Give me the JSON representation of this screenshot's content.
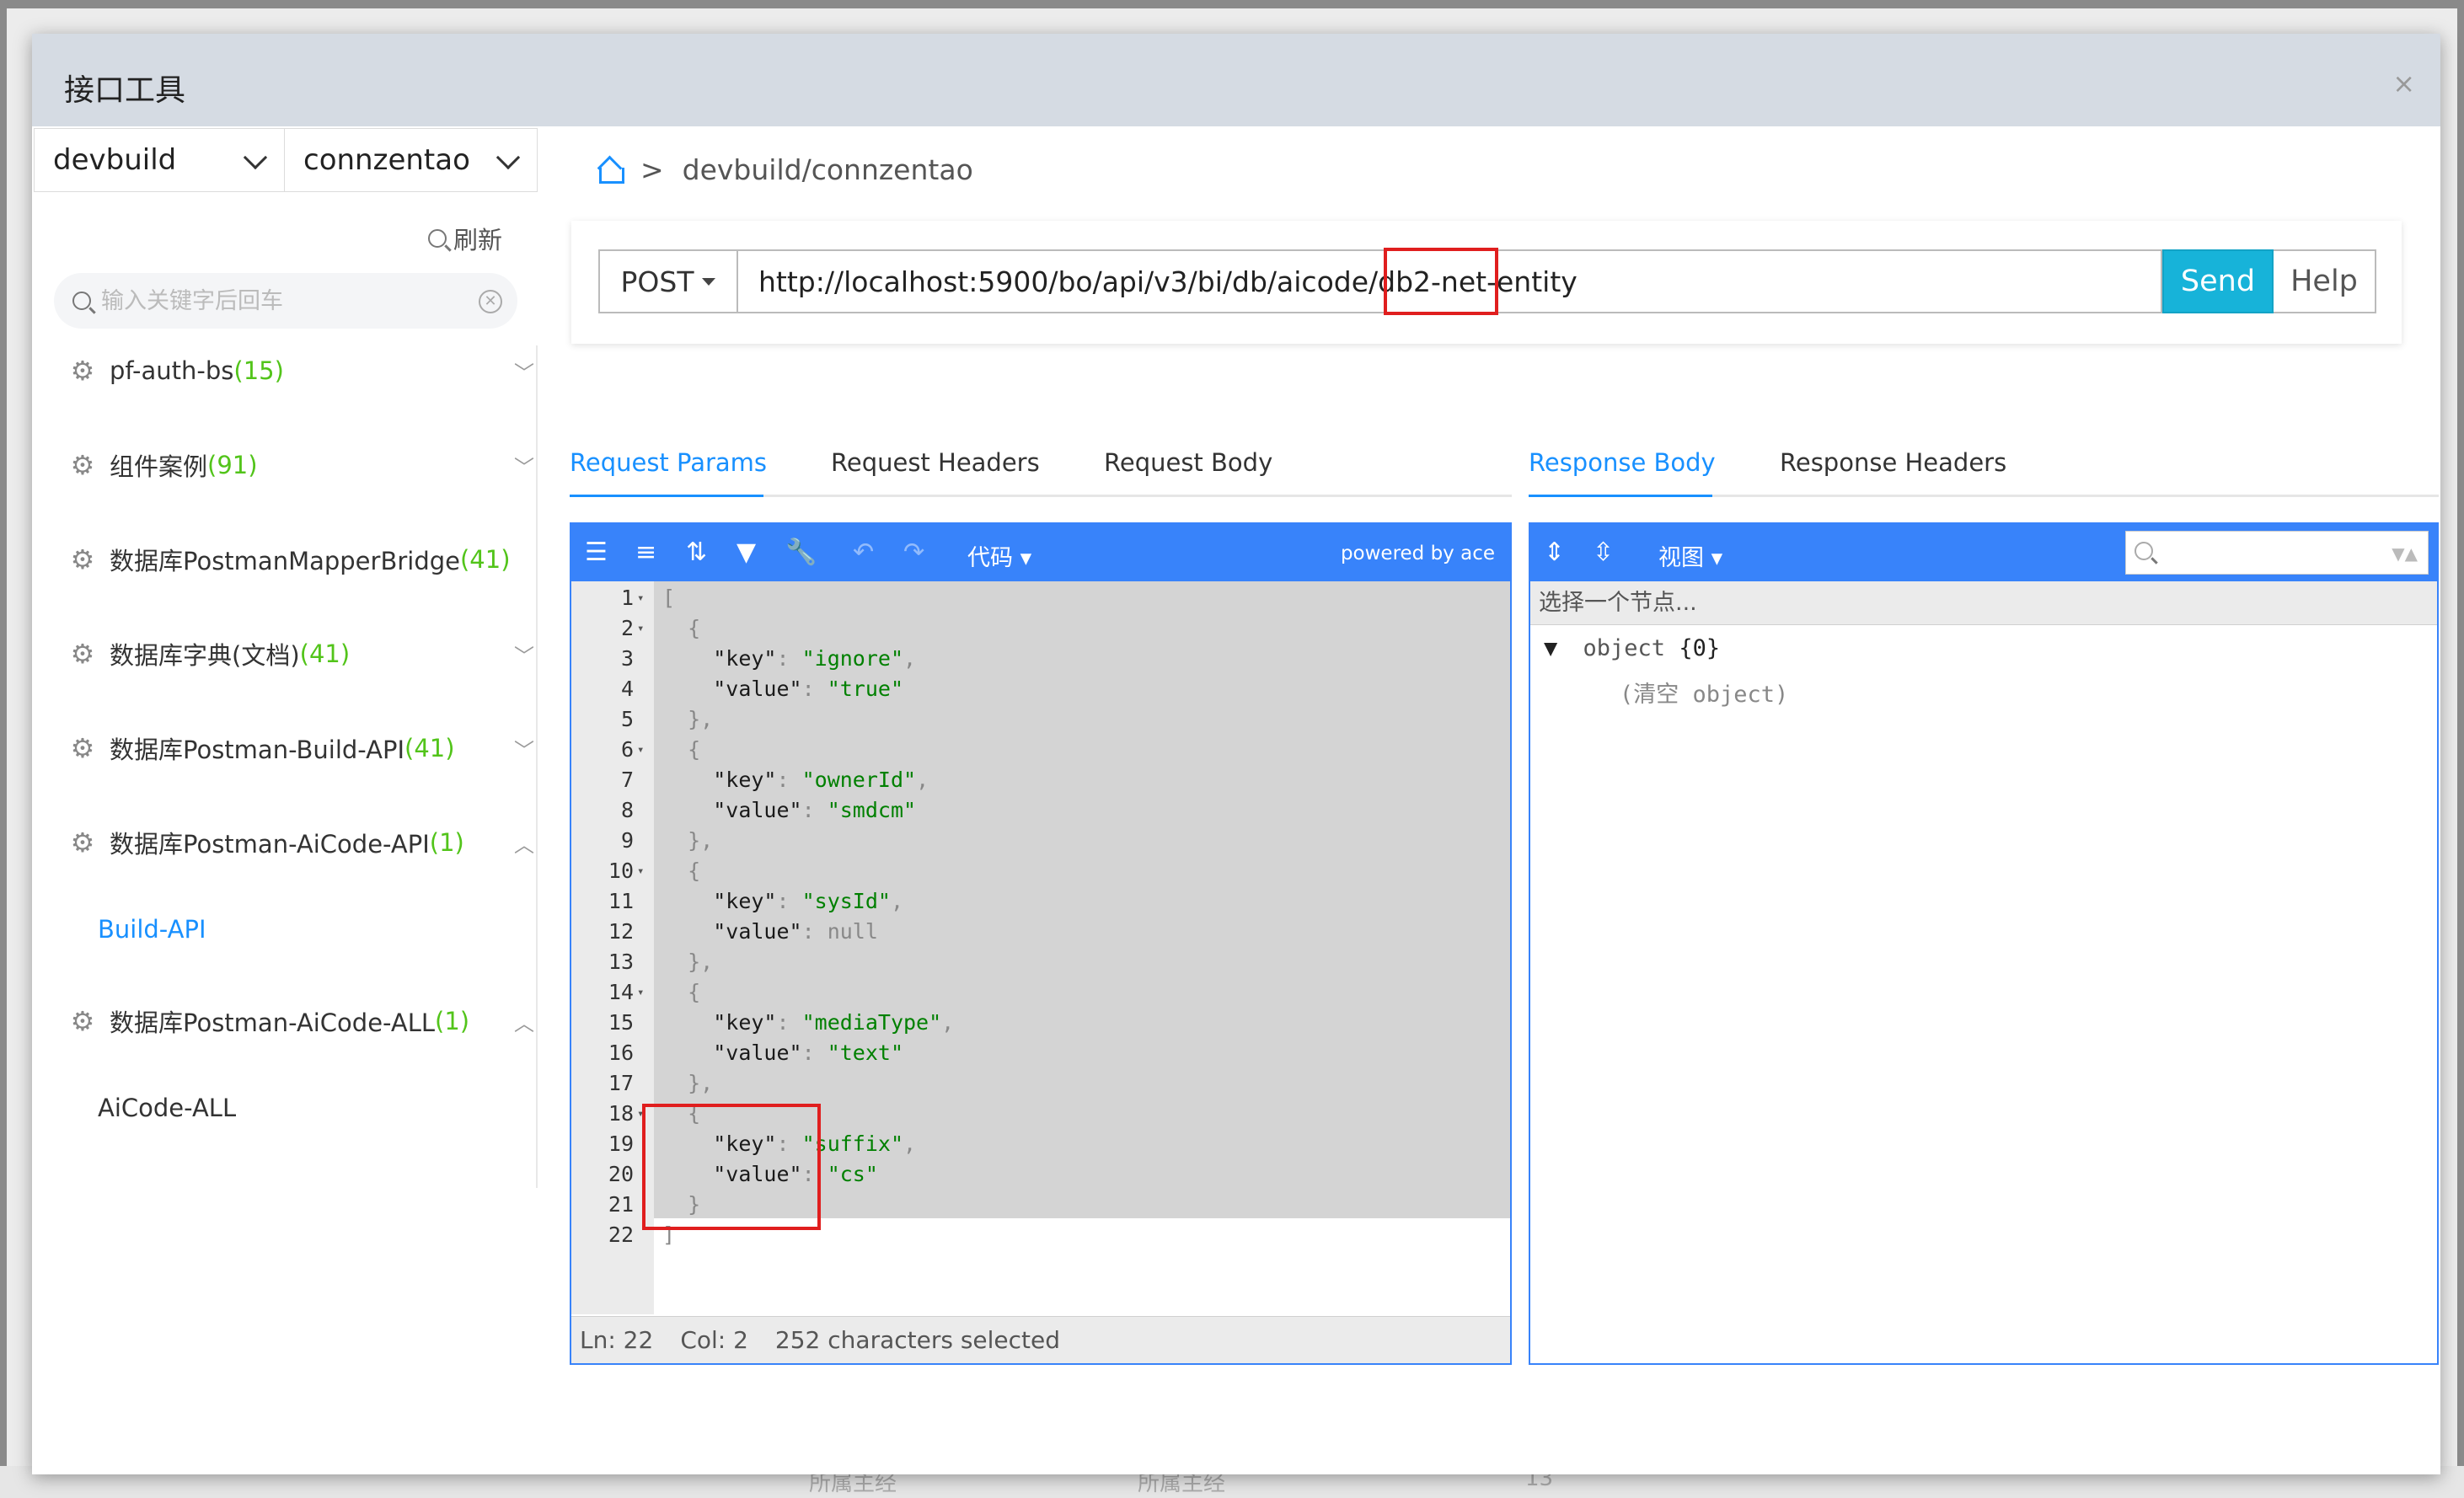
{
  "background": {
    "row_cells": [
      "所属主经",
      "所属主经",
      "13"
    ]
  },
  "modal": {
    "title": "接口工具",
    "close": "×"
  },
  "sidebar": {
    "env_select": "devbuild",
    "db_select": "connzentao",
    "refresh_label": "刷新",
    "search_placeholder": "输入关键字后回车",
    "items": [
      {
        "label": "pf-auth-bs",
        "count": "(15)",
        "expanded": false
      },
      {
        "label": "组件案例",
        "count": "(91)",
        "expanded": false
      },
      {
        "label": "数据库PostmanMapperBridge",
        "count": "(41)",
        "expanded": false
      },
      {
        "label": "数据库字典(文档)",
        "count": "(41)",
        "expanded": false
      },
      {
        "label": "数据库Postman-Build-API",
        "count": "(41)",
        "expanded": false
      },
      {
        "label": "数据库Postman-AiCode-API",
        "count": "(1)",
        "expanded": true
      },
      {
        "label": "数据库Postman-AiCode-ALL",
        "count": "(1)",
        "expanded": true
      }
    ],
    "children": [
      {
        "label": "Build-API",
        "active": true
      },
      {
        "label": "AiCode-ALL",
        "active": false
      }
    ]
  },
  "breadcrumb": {
    "path": "devbuild/connzentao"
  },
  "request": {
    "method": "POST",
    "url": "http://localhost:5900/bo/api/v3/bi/db/aicode/db2-net-entity",
    "send_label": "Send",
    "help_label": "Help"
  },
  "left_tabs": [
    "Request Params",
    "Request Headers",
    "Request Body"
  ],
  "right_tabs": [
    "Response Body",
    "Response Headers"
  ],
  "editor": {
    "mode_label": "代码",
    "powered_by": "powered by ace",
    "status": {
      "ln": "Ln: 22",
      "col": "Col: 2",
      "selected": "252 characters selected"
    },
    "lines": [
      {
        "n": "1",
        "fold": true,
        "html": "<span class='p'>[</span>"
      },
      {
        "n": "2",
        "fold": true,
        "html": "  <span class='p'>{</span>"
      },
      {
        "n": "3",
        "fold": false,
        "html": "    <span class='k'>\"key\"</span><span class='p'>: </span><span class='s'>\"ignore\"</span><span class='p'>,</span>"
      },
      {
        "n": "4",
        "fold": false,
        "html": "    <span class='k'>\"value\"</span><span class='p'>: </span><span class='s'>\"true\"</span>"
      },
      {
        "n": "5",
        "fold": false,
        "html": "  <span class='p'>},</span>"
      },
      {
        "n": "6",
        "fold": true,
        "html": "  <span class='p'>{</span>"
      },
      {
        "n": "7",
        "fold": false,
        "html": "    <span class='k'>\"key\"</span><span class='p'>: </span><span class='s'>\"ownerId\"</span><span class='p'>,</span>"
      },
      {
        "n": "8",
        "fold": false,
        "html": "    <span class='k'>\"value\"</span><span class='p'>: </span><span class='s'>\"smdcm\"</span>"
      },
      {
        "n": "9",
        "fold": false,
        "html": "  <span class='p'>},</span>"
      },
      {
        "n": "10",
        "fold": true,
        "html": "  <span class='p'>{</span>"
      },
      {
        "n": "11",
        "fold": false,
        "html": "    <span class='k'>\"key\"</span><span class='p'>: </span><span class='s'>\"sysId\"</span><span class='p'>,</span>"
      },
      {
        "n": "12",
        "fold": false,
        "html": "    <span class='k'>\"value\"</span><span class='p'>: </span><span class='n'>null</span>"
      },
      {
        "n": "13",
        "fold": false,
        "html": "  <span class='p'>},</span>"
      },
      {
        "n": "14",
        "fold": true,
        "html": "  <span class='p'>{</span>"
      },
      {
        "n": "15",
        "fold": false,
        "html": "    <span class='k'>\"key\"</span><span class='p'>: </span><span class='s'>\"mediaType\"</span><span class='p'>,</span>"
      },
      {
        "n": "16",
        "fold": false,
        "html": "    <span class='k'>\"value\"</span><span class='p'>: </span><span class='s'>\"text\"</span>"
      },
      {
        "n": "17",
        "fold": false,
        "html": "  <span class='p'>},</span>"
      },
      {
        "n": "18",
        "fold": true,
        "html": "  <span class='p'>{</span>"
      },
      {
        "n": "19",
        "fold": false,
        "html": "    <span class='k'>\"key\"</span><span class='p'>: </span><span class='s'>\"suffix\"</span><span class='p'>,</span>"
      },
      {
        "n": "20",
        "fold": false,
        "html": "    <span class='k'>\"value\"</span><span class='p'>: </span><span class='s'>\"cs\"</span>"
      },
      {
        "n": "21",
        "fold": false,
        "html": "  <span class='p'>}</span>"
      },
      {
        "n": "22",
        "fold": false,
        "html": "<span class='p'>]</span>"
      }
    ]
  },
  "response": {
    "view_label": "视图",
    "nav_placeholder": "选择一个节点...",
    "root_label": "object",
    "root_count": "{0}",
    "empty_label": "(清空 object)"
  },
  "colors": {
    "accent": "#1890ff",
    "toolbar": "#3883fa",
    "send": "#17b3d9",
    "count": "#52c41a",
    "highlight": "#e01e1e"
  }
}
